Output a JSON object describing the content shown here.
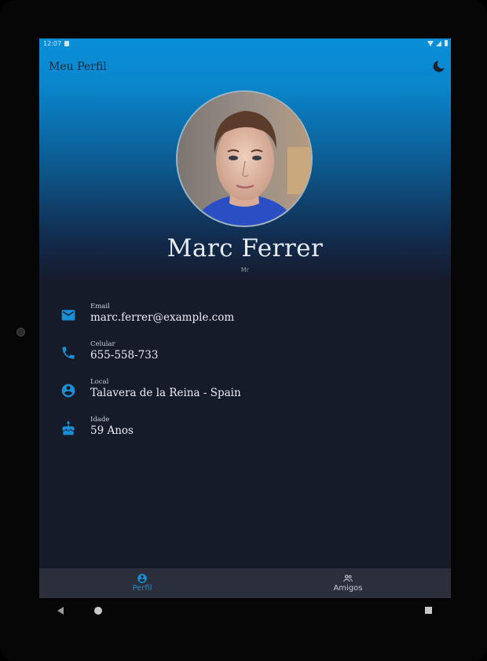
{
  "status_bar": {
    "time": "12:07"
  },
  "app_bar": {
    "title": "Meu Perfil",
    "theme_toggle_icon": "moon-icon"
  },
  "profile": {
    "name": "Marc Ferrer",
    "title": "Mr"
  },
  "info": [
    {
      "icon": "email-icon",
      "label": "Email",
      "value": "marc.ferrer@example.com"
    },
    {
      "icon": "phone-icon",
      "label": "Celular",
      "value": "655-558-733"
    },
    {
      "icon": "account-circle-icon",
      "label": "Local",
      "value": "Talavera de la Reina - Spain"
    },
    {
      "icon": "cake-icon",
      "label": "Idade",
      "value": "59 Anos"
    }
  ],
  "bottom_nav": [
    {
      "label": "Perfil",
      "icon": "account-circle-icon",
      "active": true
    },
    {
      "label": "Amigos",
      "icon": "people-icon",
      "active": false
    }
  ],
  "colors": {
    "accent": "#1a8fd6",
    "background": "#161b2a",
    "header_gradient_top": "#0a8fd8",
    "nav_background": "#2a2f3b"
  }
}
